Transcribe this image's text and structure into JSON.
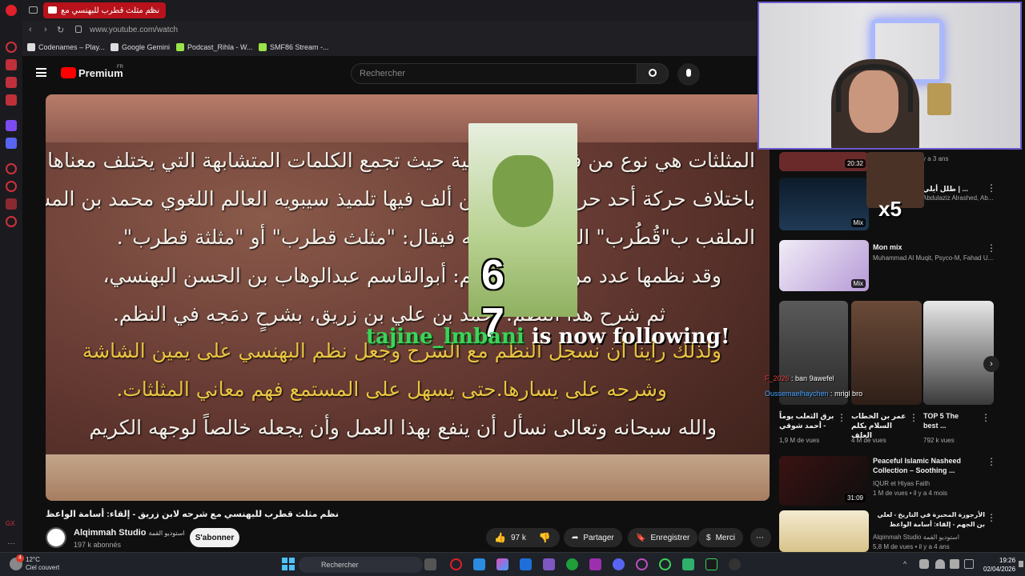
{
  "browser": {
    "tab_title": "نظم مثلث قطرب للبهنسي مع",
    "url": "www.youtube.com/watch",
    "bookmarks": [
      "Codenames – Play...",
      "Google Gemini",
      "Podcast_Rihla - W...",
      "SMF86 Stream -..."
    ]
  },
  "youtube": {
    "logo_text": "Premium",
    "logo_region": "FR",
    "search_placeholder": "Rechercher"
  },
  "video": {
    "lines": [
      "المثلثات هي نوع من فن اللغة العربية حيث تجمع الكلمات المتشابهة التي يختلف معناها",
      "باختلاف حركة أحد حروفها، وأول من ألف فيها تلميذ سيبويه العالم اللغوي محمد بن المستنير البصري",
      "الملقب ب\"قُطُرب\" الذي ينسب إليه فيقال: \"مثلث قطرب\" أو \"مثلثة قطرب\".",
      "وقد نظمها عدد من العلماء منهم: أبوالقاسم عبدالوهاب بن الحسن البهنسي،",
      "ثم شرح هذا النظم: أحمد بن علي بن زريق، بشرحٍ دمَجه في النظم.",
      "ولذلك رأينا أن نسجل النظم مع الشرح وجعل نظم البهنسي على يمين الشاشة",
      "وشرحه على يسارها.حتى يسهل على المستمع فهم معاني المثلثات.",
      "والله سبحانه وتعالى نسأل أن ينفع بهذا العمل وأن يجعله خالصاً لوجهه الكريم"
    ],
    "overlay_number": "6 7",
    "follow_user": "tajine_lmbani",
    "follow_text": " is now following!",
    "title": "نظم مثلث قطرب للبهنسي مع شرحه لابن زريق - إلقاء: أسامة الواعظ",
    "channel_name": "Alqimmah Studio",
    "channel_name_ar": "استوديو القمة",
    "channel_subs": "197 k abonnés",
    "subscribe_label": "S'abonner",
    "likes": "97 k",
    "share_label": "Partager",
    "save_label": "Enregistrer",
    "thanks_label": "Merci"
  },
  "sidebar": {
    "rec1_duration": "20:32",
    "rec1_meta": "y a 3 ans",
    "rec2_title": "طلل أيلي | ...",
    "rec2_meta": "Abdulaziz Alrashed, Ab...",
    "rec2_badge": "Mix",
    "meme_text": "x5",
    "rec3_title": "Mon mix",
    "rec3_meta": "Muhammad Al Muqit, Psyco-M, Fahad U...",
    "rec3_badge": "Mix",
    "chat": [
      {
        "user": "F_2026",
        "msg": "ban 9awefel"
      },
      {
        "user": "Oussemaelhaychen",
        "msg": "mrigl bro"
      }
    ],
    "shorts": [
      {
        "title": "برق الثعلب يوماً - أحمد شوقي",
        "views": "1,9 M de vues"
      },
      {
        "title": "عمر بن الخطاب السلام يكلم العلف",
        "views": "4 M de vues"
      },
      {
        "title": "TOP 5 The best ...",
        "views": "792 k vues"
      }
    ],
    "rec4_title": "Peaceful Islamic Nasheed Collection – Soothing ...",
    "rec4_channel": "IQUR et Hiyas Faith",
    "rec4_meta": "1 M de vues • il y a 4 mois",
    "rec4_duration": "31:09",
    "rec5_title": "الأرجوزة المحبرة في التاريخ - لعلي بن الجهم - إلقاء: أسامة الواعظ",
    "rec5_channel": "Alqimmah Studio استوديو القمة",
    "rec5_meta": "5,8 M de vues • il y a 4 ans"
  },
  "taskbar": {
    "temp": "12°C",
    "weather": "Ciel couvert",
    "weather_badge": "4",
    "search": "Rechercher",
    "time": "19:26",
    "date": "02/04/2026"
  },
  "colors": {
    "yt_red": "#ff0000",
    "opera_red": "#b8121b",
    "gold_text": "#e9c441",
    "follow_green": "#3ad45a"
  }
}
